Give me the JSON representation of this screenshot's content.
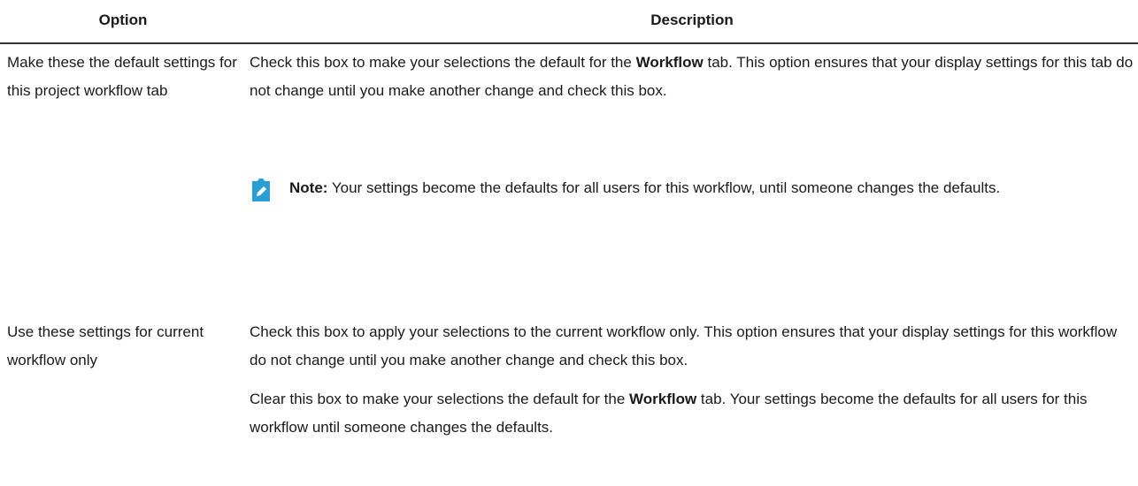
{
  "table": {
    "headers": {
      "option": "Option",
      "description": "Description"
    },
    "rows": [
      {
        "option": "Make these the default settings for this project workflow tab",
        "desc": {
          "pre": "Check this box to make your selections the default for the ",
          "bold": "Workflow",
          "post": " tab. This option ensures that your display settings for this tab do not change until you make another change and check this box."
        },
        "note": {
          "icon": "pencil-note-icon",
          "label": "Note:",
          "text": " Your settings become the defaults for all users for this workflow, until someone changes the defaults."
        }
      },
      {
        "option": "Use these settings for current workflow only",
        "desc": "Check this box to apply your selections to the current workflow only. This option ensures that your display settings for this workflow do not change until you make another change and check this box.",
        "desc2": {
          "pre": "Clear this box to make your selections the default for the ",
          "bold": "Workflow",
          "post": " tab. Your settings become the defaults for all users for this workflow until someone changes the defaults."
        }
      }
    ]
  },
  "colors": {
    "note_icon": "#2a9fd6",
    "rule": "#333333",
    "text": "#1a1a1a"
  }
}
